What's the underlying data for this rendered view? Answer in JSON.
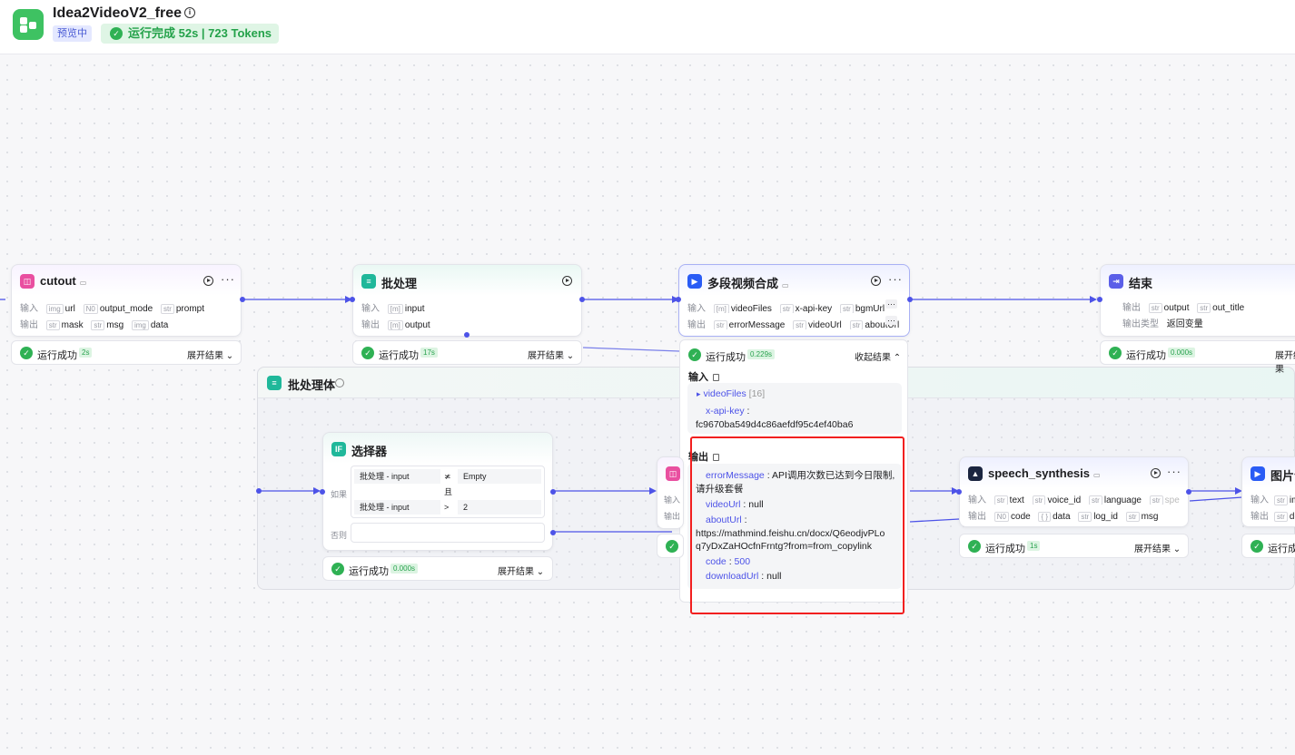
{
  "header": {
    "title": "Idea2VideoV2_free",
    "info_icon": "i",
    "preview_badge": "预览中",
    "run_status": "运行完成 52s | 723 Tokens"
  },
  "icons": {
    "check": "✓",
    "chevron_down": "⌄",
    "chevron_up": "⌃",
    "more": "···",
    "triangle_right": "▸"
  },
  "nodes": {
    "cutout": {
      "title": "cutout",
      "input_label": "输入",
      "output_label": "输出",
      "inputs": [
        {
          "type": "img",
          "name": "url"
        },
        {
          "type": "N0",
          "name": "output_mode"
        },
        {
          "type": "str",
          "name": "prompt"
        }
      ],
      "outputs": [
        {
          "type": "str",
          "name": "mask"
        },
        {
          "type": "str",
          "name": "msg"
        },
        {
          "type": "img",
          "name": "data"
        }
      ],
      "status": "运行成功",
      "time": "2s",
      "expand": "展开结果"
    },
    "batch": {
      "title": "批处理",
      "input_label": "输入",
      "output_label": "输出",
      "inputs": [
        {
          "type": "[m]",
          "name": "input"
        }
      ],
      "outputs": [
        {
          "type": "[m]",
          "name": "output"
        }
      ],
      "status": "运行成功",
      "time": "17s",
      "expand": "展开结果"
    },
    "multi_video": {
      "title": "多段视频合成",
      "input_label": "输入",
      "output_label": "输出",
      "inputs": [
        {
          "type": "[m]",
          "name": "videoFiles"
        },
        {
          "type": "str",
          "name": "x-api-key"
        },
        {
          "type": "str",
          "name": "bgmUrl"
        }
      ],
      "outputs": [
        {
          "type": "str",
          "name": "errorMessage"
        },
        {
          "type": "str",
          "name": "videoUrl"
        },
        {
          "type": "str",
          "name": "aboutUrl"
        }
      ],
      "more": "···",
      "status": "运行成功",
      "time": "0.229s",
      "collapse": "收起结果"
    },
    "end": {
      "title": "结束",
      "output_label": "输出",
      "outputs": [
        {
          "type": "str",
          "name": "output"
        },
        {
          "type": "str",
          "name": "out_title"
        }
      ],
      "output_type_label": "输出类型",
      "output_type_value": "返回变量",
      "status": "运行成功",
      "time": "0.000s",
      "expand": "展开结果"
    },
    "batch_body": {
      "title": "批处理体"
    },
    "selector": {
      "title": "选择器",
      "if_label": "如果",
      "else_label": "否则",
      "and_label": "且",
      "conditions": [
        {
          "left": "批处理 - input",
          "op": "≭",
          "right": "Empty"
        },
        {
          "left": "批处理 - input",
          "op": ">",
          "right": "2"
        }
      ],
      "status": "运行成功",
      "time": "0.000s",
      "expand": "展开结果"
    },
    "hidden_node": {
      "input_label": "输入",
      "output_label": "输出"
    },
    "speech": {
      "title": "speech_synthesis",
      "input_label": "输入",
      "output_label": "输出",
      "inputs": [
        {
          "type": "str",
          "name": "text"
        },
        {
          "type": "str",
          "name": "voice_id"
        },
        {
          "type": "str",
          "name": "language"
        },
        {
          "type": "str",
          "name": "spe"
        }
      ],
      "outputs": [
        {
          "type": "N0",
          "name": "code"
        },
        {
          "type": "{ }",
          "name": "data"
        },
        {
          "type": "str",
          "name": "log_id"
        },
        {
          "type": "str",
          "name": "msg"
        }
      ],
      "status": "运行成功",
      "time": "1s",
      "expand": "展开结果"
    },
    "image_audio": {
      "title": "图片音",
      "input_label": "输入",
      "output_label": "输出",
      "input_first": "ima",
      "output_first": "dov",
      "status": "运行成"
    }
  },
  "detail": {
    "input_heading": "输入",
    "output_heading": "输出",
    "input": {
      "videoFiles_key": "videoFiles",
      "videoFiles_count": "[16]",
      "xapikey_key": "x-api-key",
      "xapikey_value": "fc9670ba549d4c86aefdf95c4ef40ba6"
    },
    "output": {
      "errorMessage_key": "errorMessage",
      "errorMessage_value": "API调用次数已达到今日限制,",
      "errorMessage_value2": "请升级套餐",
      "videoUrl_key": "videoUrl",
      "videoUrl_value": "null",
      "aboutUrl_key": "aboutUrl",
      "aboutUrl_line1": "https://mathmind.feishu.cn/docx/Q6eodjvPLo",
      "aboutUrl_line2": "q7yDxZaHOcfnFrntg?from=from_copylink",
      "code_key": "code",
      "code_value": "500",
      "downloadUrl_key": "downloadUrl",
      "downloadUrl_value": "null"
    }
  },
  "colors": {
    "accent": "#4d53e8",
    "success": "#2fb154",
    "highlight_box": "#f21f1f"
  }
}
